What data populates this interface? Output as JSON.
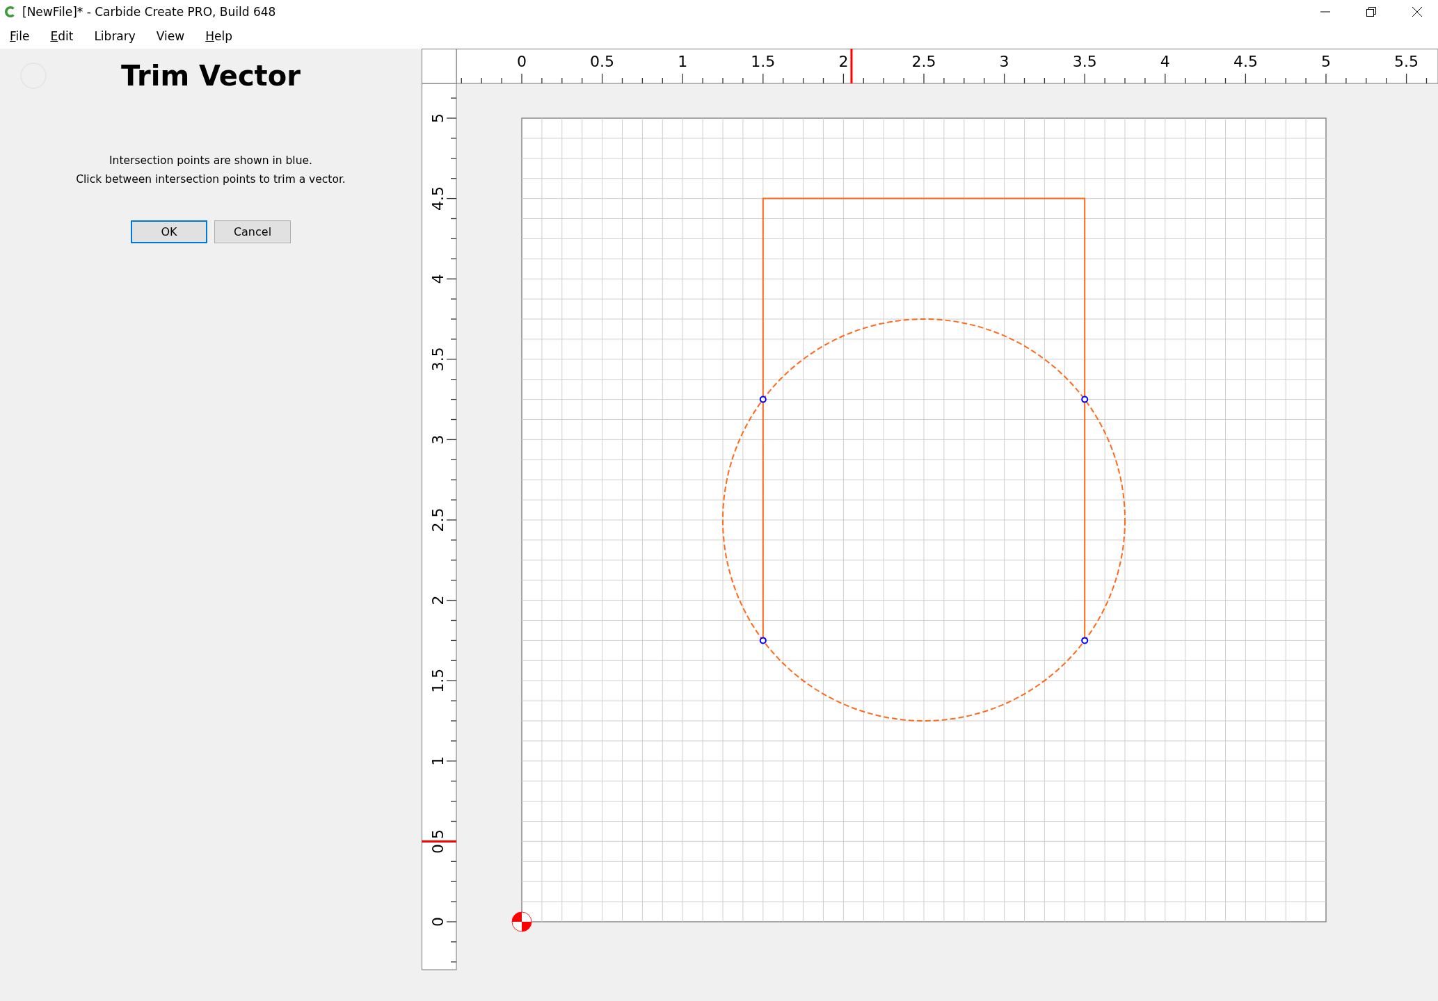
{
  "window": {
    "title": "[NewFile]* - Carbide Create PRO, Build 648"
  },
  "menu": [
    {
      "label": "File",
      "underlined_first": true
    },
    {
      "label": "Edit",
      "underlined_first": true
    },
    {
      "label": "Library",
      "underlined_first": false
    },
    {
      "label": "View",
      "underlined_first": false
    },
    {
      "label": "Help",
      "underlined_first": true
    }
  ],
  "panel": {
    "title": "Trim Vector",
    "messages": [
      "Intersection points are shown in blue.",
      "Click between intersection points to trim a vector."
    ],
    "buttons": [
      {
        "label": "OK",
        "default": true
      },
      {
        "label": "Cancel",
        "default": false
      }
    ]
  },
  "rulers": {
    "x_labels": [
      "0",
      "0.5",
      "1",
      "1.5",
      "2",
      "2.5",
      "3",
      "3.5",
      "4",
      "4.5",
      "5",
      "5.5"
    ],
    "y_labels": [
      "0",
      "0.5",
      "1",
      "1.5",
      "2",
      "2.5",
      "3",
      "3.5",
      "4",
      "4.5",
      "5"
    ]
  }
}
